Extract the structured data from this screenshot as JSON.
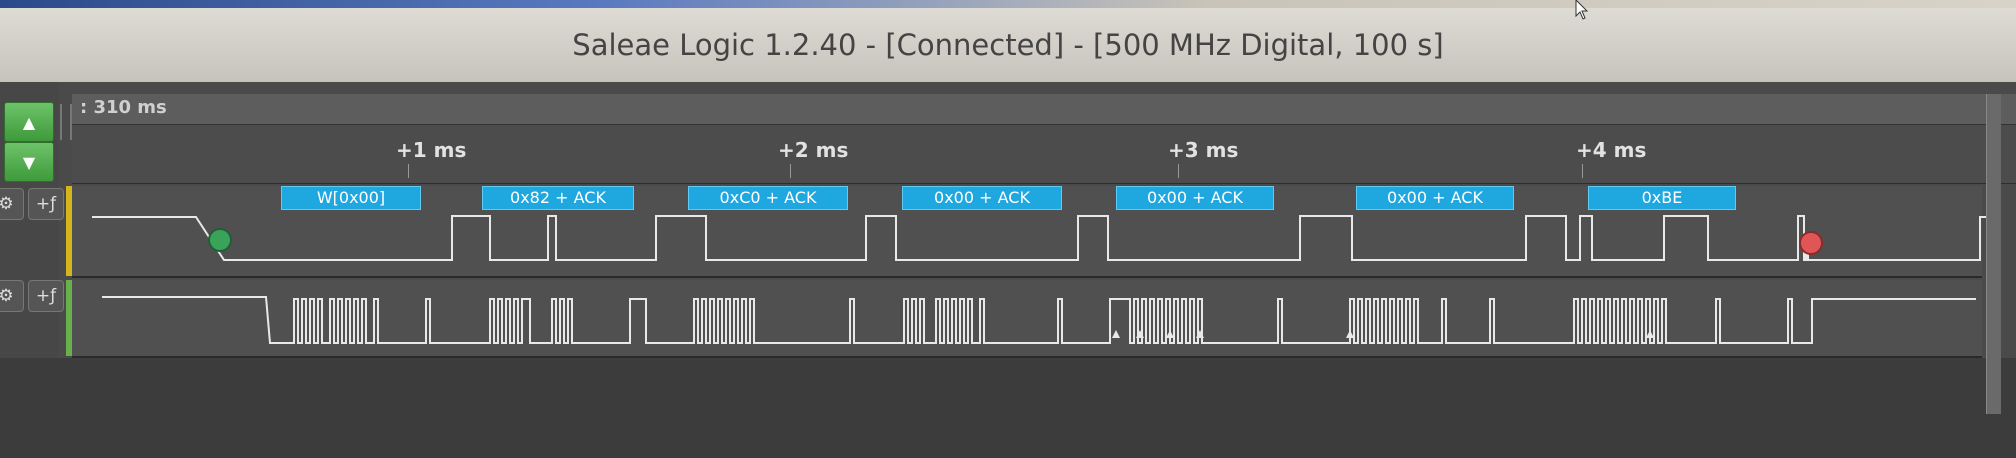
{
  "window": {
    "title": "Saleae Logic 1.2.40 - [Connected] - [500 MHz Digital, 100 s]"
  },
  "timebar": {
    "label": ": 310 ms"
  },
  "ruler": {
    "ticks": [
      "+1 ms",
      "+2 ms",
      "+3 ms",
      "+4 ms"
    ]
  },
  "channels": [
    {
      "button": "+ƒ"
    },
    {
      "button": "+ƒ"
    }
  ],
  "i2c_frames": [
    "W[0x00]",
    "0x82 + ACK",
    "0xC0 + ACK",
    "0x00 + ACK",
    "0x00 + ACK",
    "0x00 + ACK",
    "0xBE"
  ],
  "colors": {
    "frame_bubble": "#1fa8e0",
    "start_marker": "#3aa35a",
    "stop_marker": "#e05555",
    "nav_button": "#4faa4a",
    "channel0_stripe": "#d6b41e",
    "channel1_stripe": "#6ab04c"
  },
  "icons": {
    "nav_up": "triangle-up",
    "nav_down": "triangle-down",
    "settings": "gear",
    "cursor": "mouse-pointer"
  }
}
